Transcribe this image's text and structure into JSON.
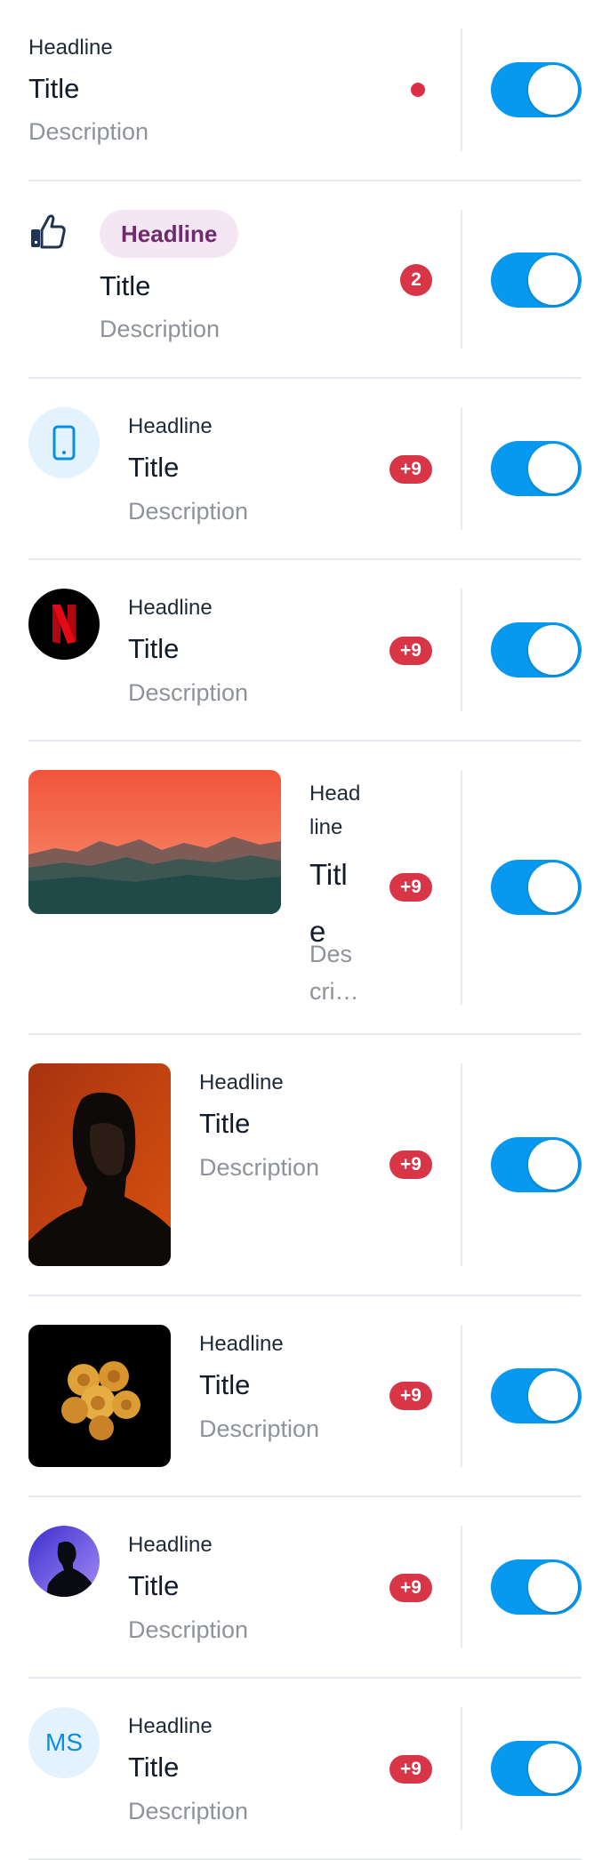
{
  "colors": {
    "accent": "#0799ef",
    "badge": "#d83546",
    "chip_bg": "#f5e6f4",
    "chip_text": "#6e2a6c",
    "divider": "#e6e9ee"
  },
  "items": [
    {
      "headline": "Headline",
      "title": "Title",
      "description": "Description",
      "indicator": "dot",
      "leading": "none",
      "toggle_on": true
    },
    {
      "headline": "Headline",
      "title": "Title",
      "description": "Description",
      "badge": "2",
      "leading": "thumbs-up-icon",
      "toggle_on": true
    },
    {
      "headline": "Headline",
      "title": "Title",
      "description": "Description",
      "badge": "+9",
      "leading": "smartphone-icon",
      "toggle_on": true
    },
    {
      "headline": "Headline",
      "title": "Title",
      "description": "Description",
      "badge": "+9",
      "leading": "netflix-logo",
      "toggle_on": true
    },
    {
      "headline_l1": "Head",
      "headline_l2": "line",
      "title_l1": "Titl",
      "title_l2": "e",
      "desc_l1": "Des",
      "desc_l2": "cri…",
      "badge": "+9",
      "leading": "sunset-mountains-image",
      "toggle_on": true
    },
    {
      "headline": "Headline",
      "title": "Title",
      "description": "Description",
      "badge": "+9",
      "leading": "portrait-photo",
      "toggle_on": true
    },
    {
      "headline": "Headline",
      "title": "Title",
      "description": "Description",
      "badge": "+9",
      "leading": "roses-photo",
      "toggle_on": true
    },
    {
      "headline": "Headline",
      "title": "Title",
      "description": "Description",
      "badge": "+9",
      "leading": "person-silhouette-avatar",
      "toggle_on": true
    },
    {
      "headline": "Headline",
      "title": "Title",
      "description": "Description",
      "badge": "+9",
      "leading": "initials-avatar",
      "initials": "MS",
      "toggle_on": true
    }
  ]
}
